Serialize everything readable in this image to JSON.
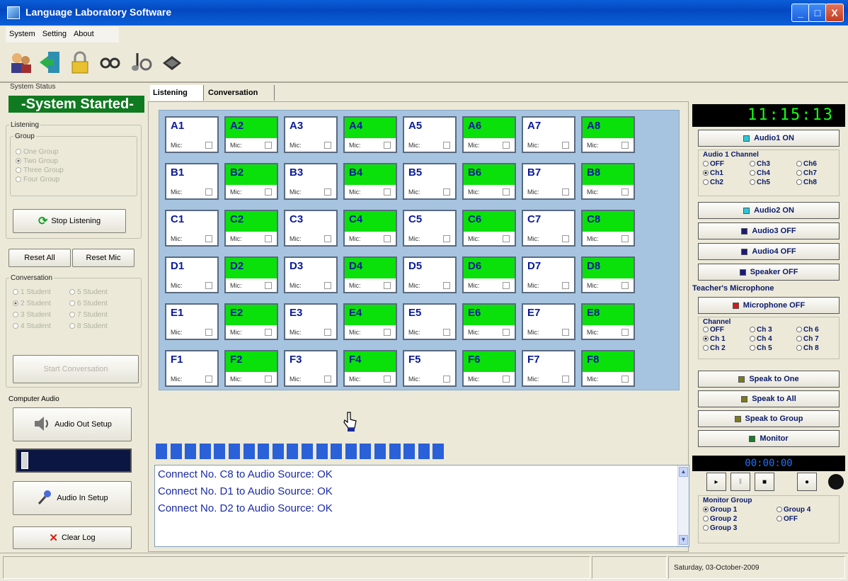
{
  "window": {
    "title": "Language Laboratory Software",
    "minimize": "_",
    "maximize": "□",
    "close": "X"
  },
  "menu": [
    "System",
    "Setting",
    "About"
  ],
  "left": {
    "system_status_label": "System Status",
    "system_status_value": "-System Started-",
    "listening_label": "Listening",
    "group_label": "Group",
    "groups": [
      "One Group",
      "Two Group",
      "Three Group",
      "Four Group"
    ],
    "selected_group": 1,
    "stop_listening": "Stop Listening",
    "reset_all": "Reset All",
    "reset_mic": "Reset Mic",
    "conversation_label": "Conversation",
    "conversation_options": [
      "1 Student",
      "5 Student",
      "2 Student",
      "6 Student",
      "3 Student",
      "7 Student",
      "4 Student",
      "8 Student"
    ],
    "selected_conversation": 2,
    "start_conversation": "Start Conversation",
    "computer_audio_label": "Computer Audio",
    "audio_out_setup": "Audio Out Setup",
    "volume_level": 0.05,
    "audio_in_setup": "Audio In Setup",
    "clear_log": "Clear Log"
  },
  "tabs": {
    "listening": "Listening",
    "conversation": "Conversation"
  },
  "students": {
    "rows": [
      "A",
      "B",
      "C",
      "D",
      "E",
      "F"
    ],
    "cols": [
      1,
      2,
      3,
      4,
      5,
      6,
      7,
      8
    ],
    "mic_label": "Mic:",
    "active_cols": [
      2,
      4,
      6,
      8
    ]
  },
  "progress_segments": 20,
  "log": [
    "Connect No. C8 to Audio Source: OK",
    "Connect No. D1 to Audio Source: OK",
    "Connect No. D2 to Audio Source: OK"
  ],
  "right": {
    "clock": "11:15:13",
    "audio1": "Audio1 ON",
    "audio1_color": "#2ec6d8",
    "audio1_channel_label": "Audio 1 Channel",
    "audio1_channels": [
      "OFF",
      "Ch3",
      "Ch6",
      "Ch1",
      "Ch4",
      "Ch7",
      "Ch2",
      "Ch5",
      "Ch8"
    ],
    "audio1_selected": "Ch1",
    "audio2": "Audio2 ON",
    "audio2_color": "#2ec6d8",
    "audio3": "Audio3 OFF",
    "audio4": "Audio4 OFF",
    "speaker": "Speaker OFF",
    "off_color": "#1a1a7a",
    "teacher_mic_label": "Teacher's Microphone",
    "microphone": "Microphone OFF",
    "microphone_color": "#d81818",
    "channel_label": "Channel",
    "channels": [
      "OFF",
      "Ch 3",
      "Ch 6",
      "Ch 1",
      "Ch 4",
      "Ch 7",
      "Ch 2",
      "Ch 5",
      "Ch 8"
    ],
    "channel_selected": "Ch 1",
    "speak_to_one": "Speak to One",
    "speak_to_all": "Speak to All",
    "speak_to_group": "Speak to Group",
    "speak_color": "#7a7a20",
    "monitor": "Monitor",
    "monitor_color": "#1a7a2a",
    "timer": "00:00:00",
    "monitor_group_label": "Monitor Group",
    "monitor_groups": [
      "Group 1",
      "Group 4",
      "Group 2",
      "OFF",
      "Group 3"
    ],
    "monitor_selected": "Group 1"
  },
  "statusbar": {
    "date": "Saturday, 03-October-2009"
  }
}
